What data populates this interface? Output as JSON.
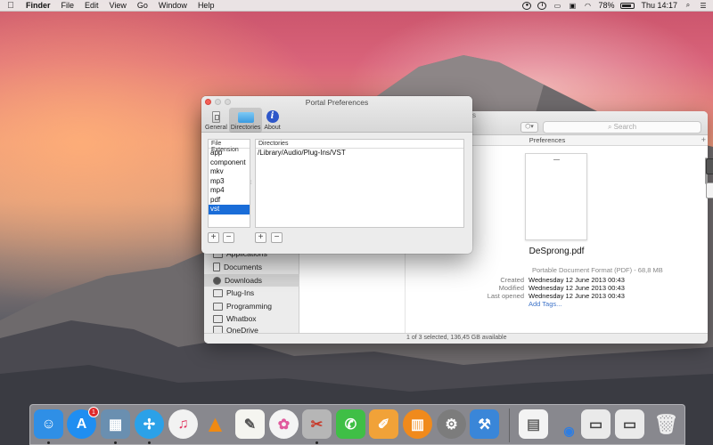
{
  "menubar": {
    "app_name": "Finder",
    "menus": [
      "File",
      "Edit",
      "View",
      "Go",
      "Window",
      "Help"
    ],
    "battery": "78%",
    "clock": "Thu 14:17",
    "status_icons": [
      "record-icon",
      "info-circle-icon",
      "airplay-icon",
      "wifi-icon",
      "battery-icon",
      "search-icon",
      "list-icon"
    ]
  },
  "finder": {
    "title_partial": "s",
    "search_placeholder": "Search",
    "column_header": "Preferences",
    "sidebar": [
      {
        "label": "Applications",
        "icon": "applications-icon"
      },
      {
        "label": "Documents",
        "icon": "documents-icon"
      },
      {
        "label": "Downloads",
        "icon": "downloads-icon",
        "selected": true
      },
      {
        "label": "Plug-Ins",
        "icon": "folder-icon"
      },
      {
        "label": "Programming",
        "icon": "folder-icon"
      },
      {
        "label": "Whatbox",
        "icon": "folder-icon"
      },
      {
        "label": "OneDrive",
        "icon": "folder-icon"
      }
    ],
    "preview": {
      "file_name": "DeSprong.pdf",
      "kind": "Portable Document Format (PDF) - 68,8 MB",
      "created_label": "Created",
      "created": "Wednesday 12 June 2013 00:43",
      "modified_label": "Modified",
      "modified": "Wednesday 12 June 2013 00:43",
      "last_opened_label": "Last opened",
      "last_opened": "Wednesday 12 June 2013 00:43",
      "add_tags": "Add Tags..."
    },
    "status": "1 of 3 selected, 136,45 GB available"
  },
  "prefs": {
    "title": "Portal Preferences",
    "tabs": [
      {
        "label": "General",
        "icon": "general-switch-icon"
      },
      {
        "label": "Directories",
        "icon": "directories-icon",
        "active": true
      },
      {
        "label": "About",
        "icon": "info-icon"
      }
    ],
    "extensions_header": "File Extension",
    "extensions": [
      "app",
      "component",
      "mkv",
      "mp3",
      "mp4",
      "pdf",
      "vst"
    ],
    "selected_extension": "vst",
    "directories_header": "Directories",
    "directories": [
      "/Library/Audio/Plug-Ins/VST"
    ],
    "add_symbol": "+",
    "remove_symbol": "−"
  },
  "dock": {
    "apps": [
      {
        "name": "Finder",
        "icon": "finder-icon",
        "color": "#2f8fe6"
      },
      {
        "name": "App Store",
        "icon": "app-store-icon",
        "color": "#1f8ef1",
        "badge": "1"
      },
      {
        "name": "Preview",
        "icon": "preview-icon",
        "color": "#6a8fb0"
      },
      {
        "name": "Safari",
        "icon": "safari-icon",
        "color": "#2ba1e8"
      },
      {
        "name": "iTunes",
        "icon": "itunes-icon",
        "color": "#f2f2f2"
      },
      {
        "name": "VLC",
        "icon": "vlc-icon",
        "color": "#f08a12"
      },
      {
        "name": "TextEdit",
        "icon": "textedit-icon",
        "color": "#f5f5f0"
      },
      {
        "name": "Photos",
        "icon": "photos-icon",
        "color": "#f4f4f4"
      },
      {
        "name": "Script Editor",
        "icon": "script-editor-icon",
        "color": "#b6b6b6"
      },
      {
        "name": "FaceTime",
        "icon": "facetime-icon",
        "color": "#3fbf46"
      },
      {
        "name": "Pages",
        "icon": "pages-icon",
        "color": "#f1a238"
      },
      {
        "name": "iBooks",
        "icon": "ibooks-icon",
        "color": "#f08a1c"
      },
      {
        "name": "System Preferences",
        "icon": "system-preferences-icon",
        "color": "#7c7c7c"
      },
      {
        "name": "Xcode",
        "icon": "xcode-icon",
        "color": "#3a86d8"
      }
    ],
    "stacks": [
      "document-stack-icon",
      "downloads-stack-icon",
      "window-stack-icon",
      "window-stack-icon-2"
    ],
    "trash": "trash-icon"
  }
}
